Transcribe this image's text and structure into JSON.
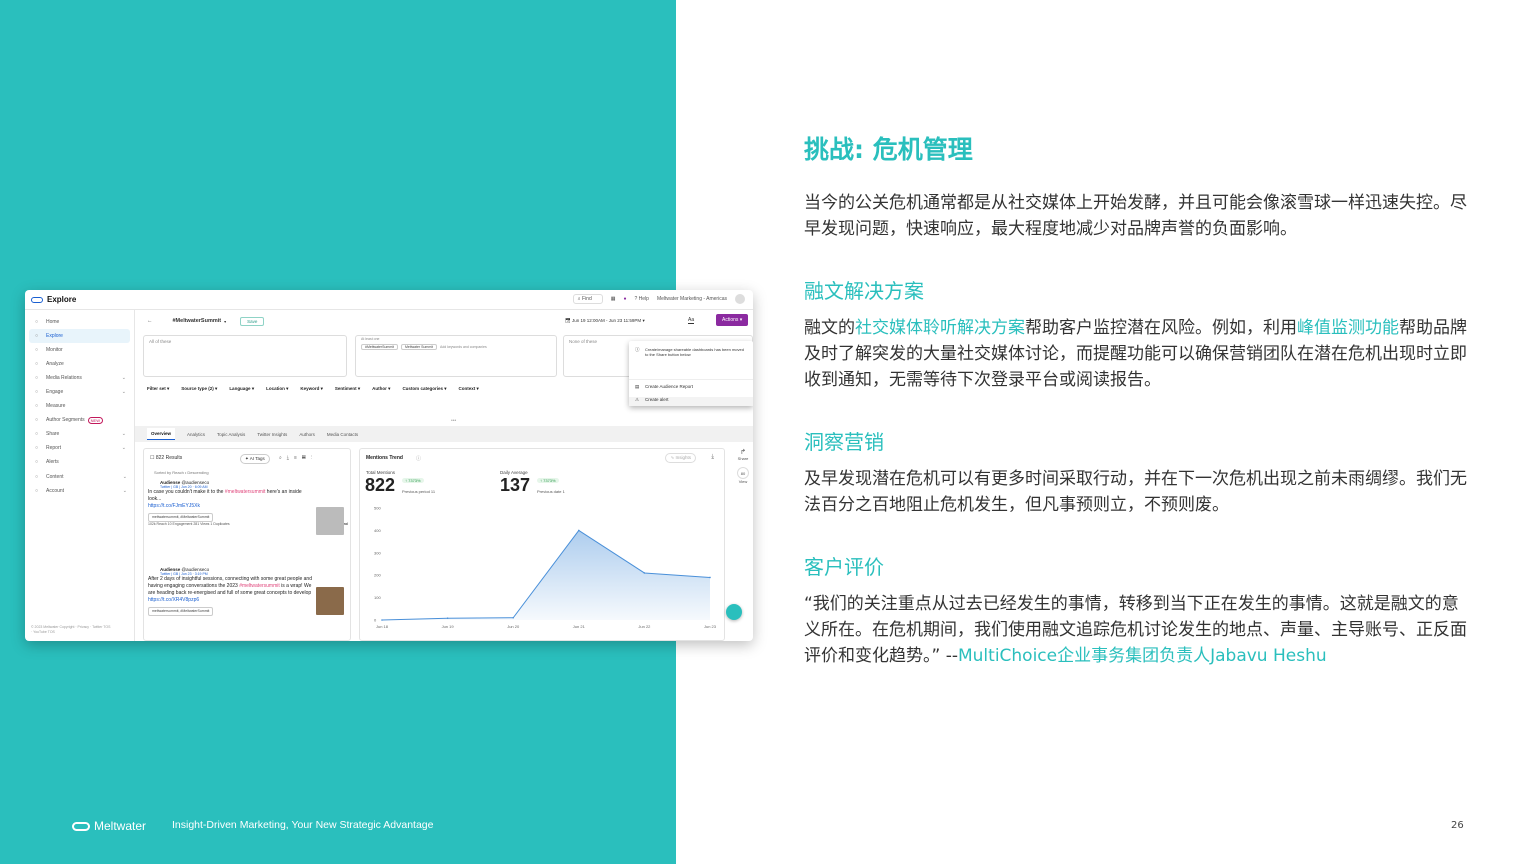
{
  "screenshot": {
    "brand": "Explore",
    "topbar": {
      "find": "Find",
      "help": "Help",
      "account": "Meltwater Marketing - Americas"
    },
    "sidebar": {
      "items": [
        {
          "label": "Home",
          "icon": "home-icon"
        },
        {
          "label": "Explore",
          "icon": "compass-icon",
          "active": true
        },
        {
          "label": "Monitor",
          "icon": "pulse-icon"
        },
        {
          "label": "Analyze",
          "icon": "chart-icon"
        },
        {
          "label": "Media Relations",
          "icon": "people-icon",
          "chevron": true
        },
        {
          "label": "Engage",
          "icon": "chat-icon",
          "chevron": true
        },
        {
          "label": "Measure",
          "icon": "measure-icon"
        },
        {
          "label": "Author Segments",
          "icon": "segments-icon",
          "badge": "NEW"
        },
        {
          "label": "Share",
          "icon": "share-icon",
          "chevron": true
        },
        {
          "label": "Report",
          "icon": "report-icon",
          "chevron": true
        },
        {
          "label": "Alerts",
          "icon": "bell-icon"
        }
      ],
      "bottom_items": [
        {
          "label": "Content",
          "icon": "content-icon"
        },
        {
          "label": "Account",
          "icon": "account-icon"
        }
      ],
      "copyright": "© 2023 Meltwater Copyright · Privacy · Twitter TOS · YouTube TOS"
    },
    "header": {
      "search_name": "#MeltwaterSummit",
      "save": "Save",
      "date_range": "Jun 19 12:00AM - Jun 23 11:59PM",
      "aa": "Aa",
      "actions": "Actions"
    },
    "keywords": {
      "all_of_these": "All of these",
      "at_least_one": "At least one",
      "chips": [
        "#MeltwaterSummit",
        "Meltwater Summit"
      ],
      "add_placeholder": "Add keywords and companies",
      "none_of_these": "None of these"
    },
    "dropdown": {
      "note": "Create/manage shareable dashboards has been moved to the Share button below",
      "item1": "Create Audience Report",
      "item2": "Create alert"
    },
    "filters": [
      "Filter set",
      "Source type (2)",
      "Language",
      "Location",
      "Keyword",
      "Sentiment",
      "Author",
      "Custom categories",
      "Context"
    ],
    "tabs": [
      "Overview",
      "Analytics",
      "Topic Analysis",
      "Twitter Insights",
      "Authors",
      "Media Contacts"
    ],
    "results": {
      "count": "822 Results",
      "ai_tags": "AI Tags",
      "sorted": "Sorted by Reach • Descending",
      "posts": [
        {
          "author": "Audiense",
          "handle": "@audienseco",
          "meta": "Twitter | GB | Jun 20 · 6:09 AM",
          "text_before": "In case you couldn't make it to the ",
          "hashtag": "#meltwatersummit",
          "text_after": " here's an inside look...",
          "link": "https://t.co/FJmEYJ5Xk",
          "tags": "meltwatersummit, #MeltwaterSummit",
          "stats": "102k Reach   10 Engagement   281 Views   1 Duplicates",
          "sentiment": "Neutral"
        },
        {
          "author": "Audiense",
          "handle": "@audienseco",
          "meta": "Twitter | GB | Jun 23 · 3:19 PM",
          "text_before": "After 2 days of insightful sessions, connecting with some great people and having engaging conversations the 2023 ",
          "hashtag": "#meltwatersummit",
          "text_after": " is a wrap! We are heading back re-energised and full of some great concepts to develop",
          "link": "https://t.co/XR4V8pzp6",
          "tags": "meltwatersummit, #MeltwaterSummit"
        }
      ]
    },
    "trend": {
      "title": "Mentions Trend",
      "insights": "Insights",
      "total_label": "Total Mentions",
      "total_value": "822",
      "total_pct": "7373%",
      "total_sub": "Previous period 11",
      "daily_label": "Daily Average",
      "daily_value": "137",
      "daily_pct": "7373%",
      "daily_sub": "Previous date 1"
    },
    "sidecol": {
      "share": "Share",
      "view": "View",
      "view_count": "80"
    }
  },
  "chart_data": {
    "type": "area",
    "categories": [
      "Jun 18",
      "Jun 19",
      "Jun 20",
      "Jun 21",
      "Jun 22",
      "Jun 23"
    ],
    "values": [
      0,
      8,
      10,
      400,
      210,
      190
    ],
    "ylim": [
      0,
      500
    ],
    "yticks": [
      "0",
      "100",
      "200",
      "300",
      "400",
      "500"
    ],
    "color": "#4a90d9"
  },
  "footer": {
    "logo": "Meltwater",
    "tagline": "Insight-Driven Marketing, Your New Strategic Advantage",
    "page": "26"
  },
  "content": {
    "title": "挑战: 危机管理",
    "p1": "当今的公关危机通常都是从社交媒体上开始发酵，并且可能会像滚雪球一样迅速失控。尽早发现问题，快速响应，最大程度地减少对品牌声誉的负面影响。",
    "h_solution": "融文解决方案",
    "p2_a": "融文的",
    "p2_link1": "社交媒体聆听解决方案",
    "p2_b": "帮助客户监控潜在风险。例如，利用",
    "p2_link2": "峰值监测功能",
    "p2_c": "帮助品牌及时了解突发的大量社交媒体讨论，而提醒功能可以确保营销团队在潜在危机出现时立即收到通知，无需等待下次登录平台或阅读报告。",
    "h_insight": "洞察营销",
    "p3": "及早发现潜在危机可以有更多时间采取行动，并在下一次危机出现之前未雨绸缪。我们无法百分之百地阻止危机发生，但凡事预则立，不预则废。",
    "h_testimonial": "客户评价",
    "p4_quote": "“我们的关注重点从过去已经发生的事情，转移到当下正在发生的事情。这就是融文的意义所在。在危机期间，我们使用融文追踪危机讨论发生的地点、声量、主导账号、正反面评价和变化趋势。”  --",
    "p4_attrib": "MultiChoice企业事务集团负责人Jabavu Heshu"
  },
  "colors": {
    "accent": "#2abfbd",
    "actions": "#8b2aa0",
    "link": "#1a5fd1"
  }
}
